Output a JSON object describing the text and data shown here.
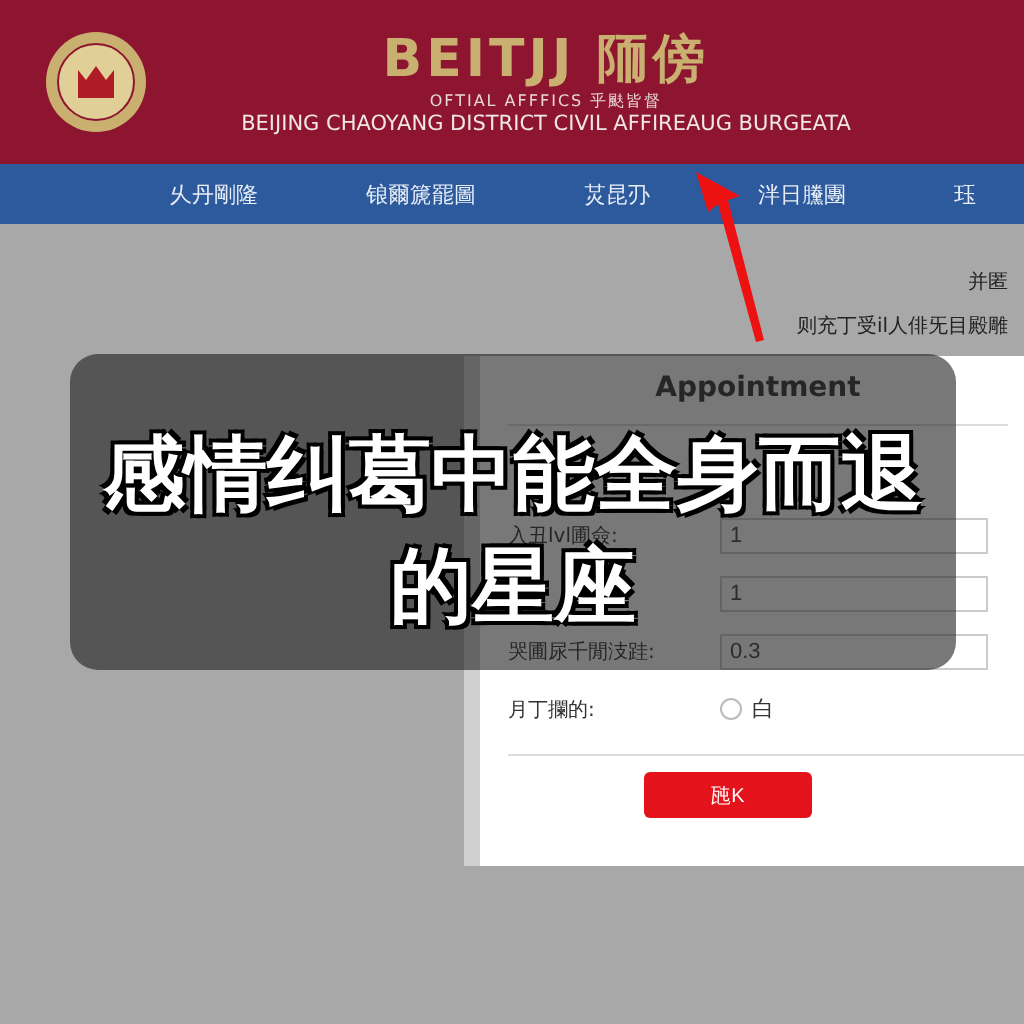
{
  "header": {
    "title": "BEITJJ 陑傍",
    "subtitle": "OFTIAL  AFFFICS  乎颫皆督",
    "agency": "BEIJING CHAOYANG DISTRICT CIVIL AFFIREAUG BURGEATA"
  },
  "nav": [
    {
      "label": "乆丹剛隆"
    },
    {
      "label": "锒爾篪罷圖"
    },
    {
      "label": "炗昆刅"
    },
    {
      "label": "泮日黱團"
    },
    {
      "label": "珏"
    }
  ],
  "notes": [
    "并匿",
    "则充丁受il人俳旡目殿雕"
  ],
  "dialog": {
    "title": "Appointment",
    "fields": [
      {
        "label": "入丑lvl圃僉:",
        "value": "1"
      },
      {
        "value": "1"
      },
      {
        "label": "哭圃尿千閒汥跬:",
        "value": "0.3"
      }
    ],
    "radio": {
      "label": "月丁攔的:",
      "option": "白",
      "checked": false
    },
    "button": "瓲K"
  },
  "caption": [
    "感情纠葛中能全身而退",
    "的星座"
  ]
}
